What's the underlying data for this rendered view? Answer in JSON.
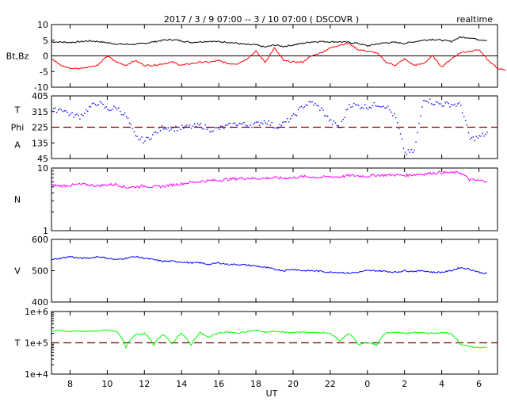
{
  "header": {
    "title": "2017 / 3 / 9   07:00 --  3 / 10   07:00 ( DSCOVR )",
    "mode": "realtime"
  },
  "chart_data": {
    "type": "line",
    "xlabel": "UT",
    "x_start_hour": 7,
    "x_span_hours": 24,
    "x_step_hours": 0.5,
    "x_tick_labels": [
      "8",
      "10",
      "12",
      "14",
      "16",
      "18",
      "20",
      "22",
      "0",
      "2",
      "4",
      "6"
    ],
    "colors": {
      "bt": "#000000",
      "bz": "#ff0000",
      "phi": "#0000ff",
      "n": "#ff00ff",
      "v": "#0000ff",
      "t": "#00ff00",
      "refline": "#800000"
    },
    "panels": [
      {
        "id": "mag",
        "ylabels": [
          "Bt,Bz"
        ],
        "scale": "linear",
        "ylim": [
          -10,
          10
        ],
        "tick_labels": [
          "10",
          "5",
          "0",
          "-5",
          "-10"
        ],
        "tick_values": [
          10,
          5,
          0,
          -5,
          -10
        ],
        "refline": {
          "value": 0,
          "style": "solid"
        },
        "series": [
          {
            "name": "Bt",
            "color_key": "bt",
            "values": [
              4.5,
              4.4,
              4.3,
              4.5,
              4.8,
              4.6,
              4.2,
              3.8,
              3.7,
              3.7,
              4.0,
              4.5,
              5.0,
              5.2,
              4.8,
              4.3,
              4.5,
              4.7,
              4.5,
              4.4,
              4.0,
              3.6,
              3.5,
              2.8,
              3.5,
              3.0,
              3.5,
              4.0,
              4.5,
              4.6,
              4.5,
              4.5,
              4.3,
              4.0,
              3.2,
              3.8,
              4.2,
              4.3,
              4.0,
              4.5,
              5.0,
              5.3,
              5.0,
              4.6,
              6.0,
              5.8,
              5.2,
              5.0
            ]
          },
          {
            "name": "Bz",
            "color_key": "bz",
            "values": [
              -1,
              -3,
              -4,
              -4,
              -3.5,
              -3,
              0,
              -2,
              -3,
              -1.5,
              -3,
              -3,
              -2.5,
              -2,
              -3,
              -2.5,
              -2,
              -2,
              -1.5,
              -2.5,
              -2.5,
              -1,
              1.5,
              -2,
              2.5,
              -1.5,
              -2,
              -2,
              0,
              1,
              2.5,
              3.5,
              4,
              2,
              1.5,
              1,
              -2,
              -3,
              -1,
              -3,
              -2.5,
              0,
              -3.5,
              -1,
              1,
              1.5,
              2,
              -1.5,
              -4,
              -4.5
            ]
          }
        ]
      },
      {
        "id": "phi",
        "ylabels": [
          "T",
          "Phi",
          "A"
        ],
        "scale": "linear",
        "ylim": [
          45,
          405
        ],
        "tick_labels": [
          "405",
          "315",
          "225",
          "135",
          "45"
        ],
        "tick_values": [
          405,
          315,
          225,
          135,
          45
        ],
        "refline": {
          "value": 225,
          "style": "dashed"
        },
        "series": [
          {
            "name": "Phi",
            "color_key": "phi",
            "style": "dots",
            "values": [
              320,
              335,
              300,
              290,
              340,
              370,
              330,
              340,
              290,
              170,
              150,
              190,
              230,
              220,
              225,
              230,
              240,
              215,
              220,
              235,
              250,
              240,
              245,
              265,
              230,
              250,
              290,
              350,
              370,
              330,
              260,
              230,
              360,
              350,
              345,
              360,
              350,
              280,
              80,
              90,
              395,
              370,
              360,
              360,
              355,
              160,
              170,
              200
            ]
          }
        ]
      },
      {
        "id": "n",
        "ylabels": [
          "N"
        ],
        "scale": "log",
        "ylim": [
          1,
          10
        ],
        "tick_labels": [
          "10",
          "1"
        ],
        "tick_values": [
          10,
          1
        ],
        "series": [
          {
            "name": "N",
            "color_key": "n",
            "values": [
              5.3,
              5.2,
              5.3,
              5.5,
              5.4,
              5.2,
              5.4,
              5.5,
              4.9,
              5.0,
              5.2,
              5.0,
              5.1,
              5.4,
              5.6,
              5.9,
              6.1,
              6.3,
              6.4,
              6.6,
              6.8,
              6.9,
              6.8,
              6.9,
              7.0,
              6.9,
              7.0,
              7.3,
              7.2,
              7.1,
              7.3,
              7.2,
              7.6,
              7.5,
              7.4,
              7.7,
              7.7,
              7.8,
              7.6,
              7.9,
              8.0,
              8.3,
              8.5,
              8.4,
              8.5,
              6.5,
              6.3,
              6.2
            ]
          }
        ]
      },
      {
        "id": "v",
        "ylabels": [
          "V"
        ],
        "scale": "linear",
        "ylim": [
          400,
          600
        ],
        "tick_labels": [
          "600",
          "500",
          "400"
        ],
        "tick_values": [
          600,
          500,
          400
        ],
        "series": [
          {
            "name": "V",
            "color_key": "v",
            "values": [
              535,
              540,
              545,
              540,
              540,
              545,
              540,
              535,
              540,
              545,
              540,
              535,
              530,
              530,
              528,
              525,
              525,
              520,
              525,
              520,
              520,
              518,
              515,
              510,
              505,
              500,
              505,
              500,
              500,
              498,
              495,
              495,
              492,
              495,
              500,
              500,
              498,
              495,
              500,
              498,
              500,
              495,
              495,
              500,
              510,
              505,
              495,
              490
            ]
          }
        ]
      },
      {
        "id": "t",
        "ylabels": [
          "T"
        ],
        "scale": "log",
        "ylim": [
          10000,
          1000000
        ],
        "tick_labels": [
          "1e+6",
          "1e+5",
          "1e+4"
        ],
        "tick_values": [
          1000000,
          100000,
          10000
        ],
        "refline": {
          "value": 100000,
          "style": "dashed"
        },
        "series": [
          {
            "name": "T",
            "color_key": "t",
            "values": [
              230000,
              250000,
              230000,
              240000,
              230000,
              240000,
              250000,
              230000,
              70000,
              180000,
              200000,
              80000,
              190000,
              90000,
              200000,
              80000,
              210000,
              150000,
              210000,
              220000,
              200000,
              230000,
              250000,
              220000,
              230000,
              220000,
              210000,
              220000,
              210000,
              210000,
              200000,
              110000,
              200000,
              90000,
              100000,
              85000,
              210000,
              220000,
              200000,
              210000,
              210000,
              200000,
              210000,
              200000,
              90000,
              75000,
              70000,
              75000
            ]
          }
        ]
      }
    ]
  }
}
